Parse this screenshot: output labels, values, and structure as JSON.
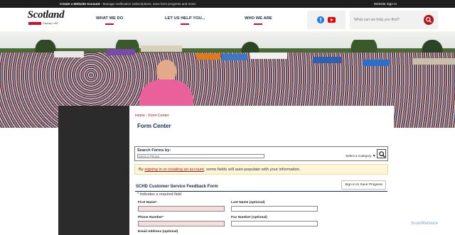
{
  "topbar": {
    "create_label": "Create a Website Account",
    "create_desc": " - Manage notification subscriptions, save form progress and more.",
    "signin_label": "Website Sign In"
  },
  "logo": {
    "name": "Scotland",
    "tagline": "County • NC"
  },
  "nav": [
    {
      "label": "WHAT WE DO"
    },
    {
      "label": "LET US HELP YOU..."
    },
    {
      "label": "WHO WE ARE"
    }
  ],
  "social": {
    "facebook_icon": "f"
  },
  "site_search": {
    "placeholder": "What can we help you find?"
  },
  "breadcrumb": {
    "home": "Home",
    "separator": "›",
    "current": "Form Center"
  },
  "page_title": "Form Center",
  "search_forms": {
    "label": "Search Forms by:",
    "placeholder": "Word or Phrase",
    "category_label": "Select a Category",
    "category_arrow": "▼"
  },
  "notice": {
    "prefix": "By ",
    "link": "signing in or creating an account",
    "suffix": ", some fields will auto-populate with your information."
  },
  "form": {
    "title": "SCHD Customer Service Feedback Form",
    "save_button": "Sign in to Save Progress",
    "required_note": "* indicates a required field",
    "required_star": "*",
    "fields": {
      "first_name": "First Name",
      "last_name": "Last Name (optional)",
      "phone": "Phone Number",
      "fax": "Fax Number (optional)",
      "email": "Email Address (optional)"
    }
  },
  "watermark": "ScanMalware",
  "colors": {
    "accent": "#b5121b",
    "navy": "#1b2a4a",
    "required_bg": "#f7dede",
    "notice_bg": "#fdf6d6"
  }
}
